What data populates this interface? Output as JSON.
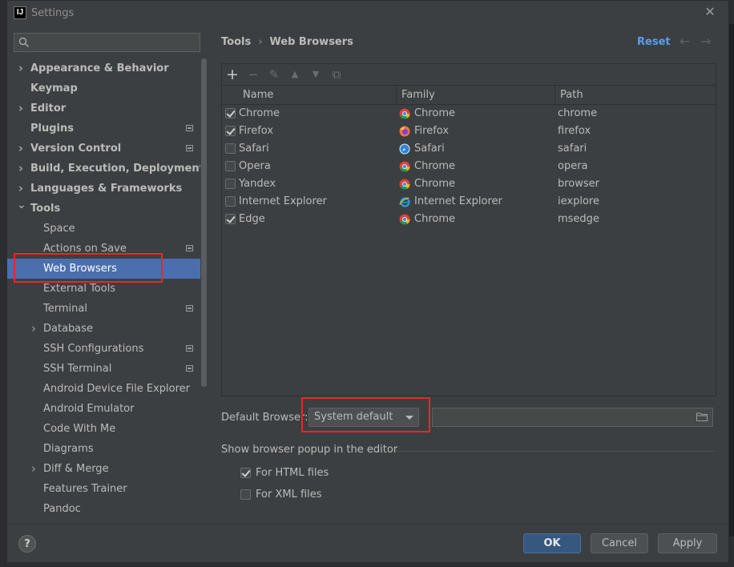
{
  "window": {
    "title": "Settings",
    "app_icon": "IJ"
  },
  "sidebar": {
    "search_placeholder": "",
    "items": [
      {
        "label": "Appearance & Behavior",
        "level": 0,
        "expandable": true,
        "expanded": false,
        "bold": true,
        "badge": false
      },
      {
        "label": "Keymap",
        "level": 0,
        "expandable": false,
        "bold": true,
        "badge": false
      },
      {
        "label": "Editor",
        "level": 0,
        "expandable": true,
        "expanded": false,
        "bold": true,
        "badge": false
      },
      {
        "label": "Plugins",
        "level": 0,
        "expandable": false,
        "bold": true,
        "badge": true
      },
      {
        "label": "Version Control",
        "level": 0,
        "expandable": true,
        "expanded": false,
        "bold": true,
        "badge": true
      },
      {
        "label": "Build, Execution, Deployment",
        "level": 0,
        "expandable": true,
        "expanded": false,
        "bold": true,
        "badge": false
      },
      {
        "label": "Languages & Frameworks",
        "level": 0,
        "expandable": true,
        "expanded": false,
        "bold": true,
        "badge": false
      },
      {
        "label": "Tools",
        "level": 0,
        "expandable": true,
        "expanded": true,
        "bold": true,
        "badge": false
      },
      {
        "label": "Space",
        "level": 1,
        "expandable": false,
        "bold": false,
        "badge": false
      },
      {
        "label": "Actions on Save",
        "level": 1,
        "expandable": false,
        "bold": false,
        "badge": true
      },
      {
        "label": "Web Browsers",
        "level": 1,
        "expandable": false,
        "bold": false,
        "badge": false,
        "selected": true
      },
      {
        "label": "External Tools",
        "level": 1,
        "expandable": false,
        "bold": false,
        "badge": false
      },
      {
        "label": "Terminal",
        "level": 1,
        "expandable": false,
        "bold": false,
        "badge": true
      },
      {
        "label": "Database",
        "level": 1,
        "expandable": true,
        "expanded": false,
        "bold": false,
        "badge": false
      },
      {
        "label": "SSH Configurations",
        "level": 1,
        "expandable": false,
        "bold": false,
        "badge": true
      },
      {
        "label": "SSH Terminal",
        "level": 1,
        "expandable": false,
        "bold": false,
        "badge": true
      },
      {
        "label": "Android Device File Explorer",
        "level": 1,
        "expandable": false,
        "bold": false,
        "badge": false
      },
      {
        "label": "Android Emulator",
        "level": 1,
        "expandable": false,
        "bold": false,
        "badge": false
      },
      {
        "label": "Code With Me",
        "level": 1,
        "expandable": false,
        "bold": false,
        "badge": false
      },
      {
        "label": "Diagrams",
        "level": 1,
        "expandable": false,
        "bold": false,
        "badge": false
      },
      {
        "label": "Diff & Merge",
        "level": 1,
        "expandable": true,
        "expanded": false,
        "bold": false,
        "badge": false
      },
      {
        "label": "Features Trainer",
        "level": 1,
        "expandable": false,
        "bold": false,
        "badge": false
      },
      {
        "label": "Pandoc",
        "level": 1,
        "expandable": false,
        "bold": false,
        "badge": false
      }
    ]
  },
  "header": {
    "breadcrumb_parent": "Tools",
    "breadcrumb_separator": "›",
    "breadcrumb_current": "Web Browsers",
    "reset_label": "Reset",
    "back_arrow": "←",
    "forward_arrow": "→"
  },
  "toolbar": {
    "add": "+",
    "remove": "−",
    "edit": "✎",
    "up": "▲",
    "down": "▼",
    "copy": "⧉"
  },
  "table": {
    "columns": [
      "Name",
      "Family",
      "Path"
    ],
    "rows": [
      {
        "checked": true,
        "name": "Chrome",
        "family": "Chrome",
        "family_icon": "chrome-icon",
        "path": "chrome"
      },
      {
        "checked": true,
        "name": "Firefox",
        "family": "Firefox",
        "family_icon": "firefox-icon",
        "path": "firefox"
      },
      {
        "checked": false,
        "name": "Safari",
        "family": "Safari",
        "family_icon": "safari-icon",
        "path": "safari"
      },
      {
        "checked": false,
        "name": "Opera",
        "family": "Chrome",
        "family_icon": "chrome-icon",
        "path": "opera"
      },
      {
        "checked": false,
        "name": "Yandex",
        "family": "Chrome",
        "family_icon": "chrome-icon",
        "path": "browser"
      },
      {
        "checked": false,
        "name": "Internet Explorer",
        "family": "Internet Explorer",
        "family_icon": "ie-icon",
        "path": "iexplore"
      },
      {
        "checked": true,
        "name": "Edge",
        "family": "Chrome",
        "family_icon": "chrome-icon",
        "path": "msedge"
      }
    ]
  },
  "default_browser": {
    "label": "Default Browser:",
    "selected": "System default",
    "path_value": ""
  },
  "popup": {
    "heading": "Show browser popup in the editor",
    "options": [
      {
        "label": "For HTML files",
        "checked": true
      },
      {
        "label": "For XML files",
        "checked": false
      }
    ]
  },
  "footer": {
    "help": "?",
    "ok": "OK",
    "cancel": "Cancel",
    "apply": "Apply"
  },
  "colors": {
    "accent": "#4b6eaf",
    "primary_button": "#365880",
    "link": "#589df6",
    "highlight_box": "#e8272a",
    "background": "#3c3f41"
  }
}
